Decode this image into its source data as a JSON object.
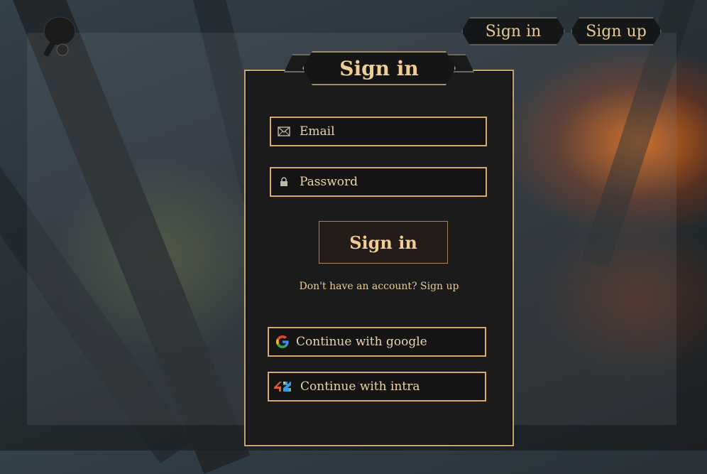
{
  "nav": {
    "signin_label": "Sign in",
    "signup_label": "Sign up"
  },
  "form": {
    "title": "Sign in",
    "email_placeholder": "Email",
    "password_placeholder": "Password",
    "submit_label": "Sign in",
    "switch_prefix": "Don't have an account?",
    "switch_link": "Sign up"
  },
  "oauth": {
    "google_label": "Continue with google",
    "intra_label": "Continue with intra"
  },
  "icons": {
    "logo": "ping-pong-paddle-icon",
    "email": "envelope-icon",
    "password": "lock-icon",
    "google": "google-icon",
    "intra": "42-icon"
  },
  "colors": {
    "accent_gold": "#d4aa64",
    "title_text": "#f0cd92",
    "card_bg": "#1b1b1b"
  }
}
